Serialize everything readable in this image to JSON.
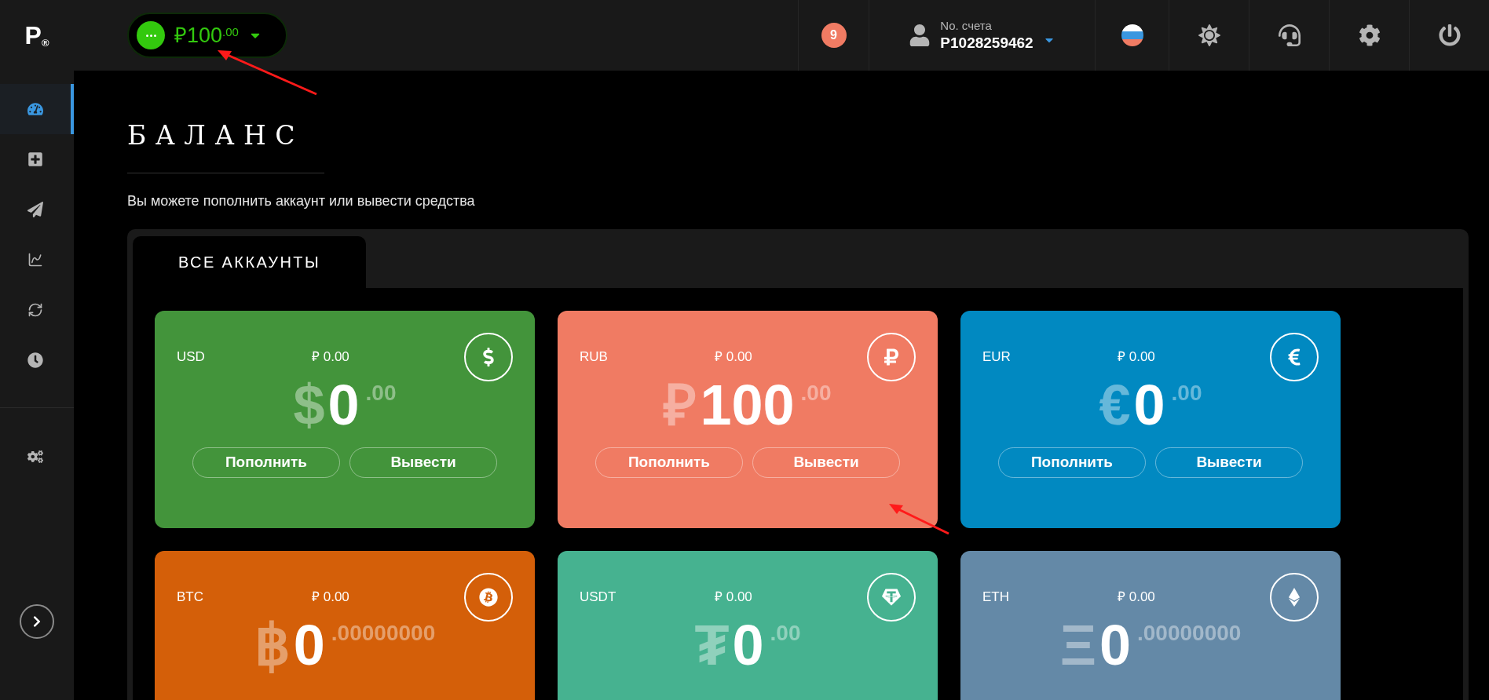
{
  "logo": {
    "letter": "P",
    "mark": "®"
  },
  "balance_pill": {
    "currency": "₽",
    "amount": "100",
    "decimals": ".00"
  },
  "header": {
    "notifications": "9",
    "account_label": "No. счета",
    "account_number": "P1028259462"
  },
  "sidebar": {
    "items": [
      {
        "kind": "gauge",
        "selected": true
      },
      {
        "kind": "plus",
        "selected": false
      },
      {
        "kind": "send",
        "selected": false
      },
      {
        "kind": "chart",
        "selected": false
      },
      {
        "kind": "exchange",
        "selected": false
      },
      {
        "kind": "clock",
        "selected": false
      }
    ],
    "bottom_items": [
      {
        "kind": "gears",
        "selected": false
      }
    ]
  },
  "page": {
    "title": "БАЛАНС",
    "subtitle": "Вы можете пополнить аккаунт или вывести средства"
  },
  "tabs": [
    {
      "label": "ВСЕ АККАУНТЫ",
      "selected": true
    }
  ],
  "accounts": [
    {
      "code": "USD",
      "rub_value": "₽ 0.00",
      "symbol": "$",
      "amount": "0",
      "decimals": ".00",
      "kind": "dollar",
      "color": "#43943b",
      "buttons": [
        "Пополнить",
        "Вывести"
      ]
    },
    {
      "code": "RUB",
      "rub_value": "₽ 0.00",
      "symbol": "₽",
      "amount": "100",
      "decimals": ".00",
      "kind": "ruble",
      "color": "#f07b63",
      "buttons": [
        "Пополнить",
        "Вывести"
      ]
    },
    {
      "code": "EUR",
      "rub_value": "₽ 0.00",
      "symbol": "€",
      "amount": "0",
      "decimals": ".00",
      "kind": "euro",
      "color": "#0189c1",
      "buttons": [
        "Пополнить",
        "Вывести"
      ]
    },
    {
      "code": "BTC",
      "rub_value": "₽ 0.00",
      "symbol": "฿",
      "amount": "0",
      "decimals": ".00000000",
      "kind": "bitcoin",
      "color": "#d45f09"
    },
    {
      "code": "USDT",
      "rub_value": "₽ 0.00",
      "symbol": "₮",
      "amount": "0",
      "decimals": ".00",
      "kind": "tether",
      "color": "#46b290"
    },
    {
      "code": "ETH",
      "rub_value": "₽ 0.00",
      "symbol": "Ξ",
      "amount": "0",
      "decimals": ".00000000",
      "kind": "ethereum",
      "color": "#6489a7"
    }
  ]
}
